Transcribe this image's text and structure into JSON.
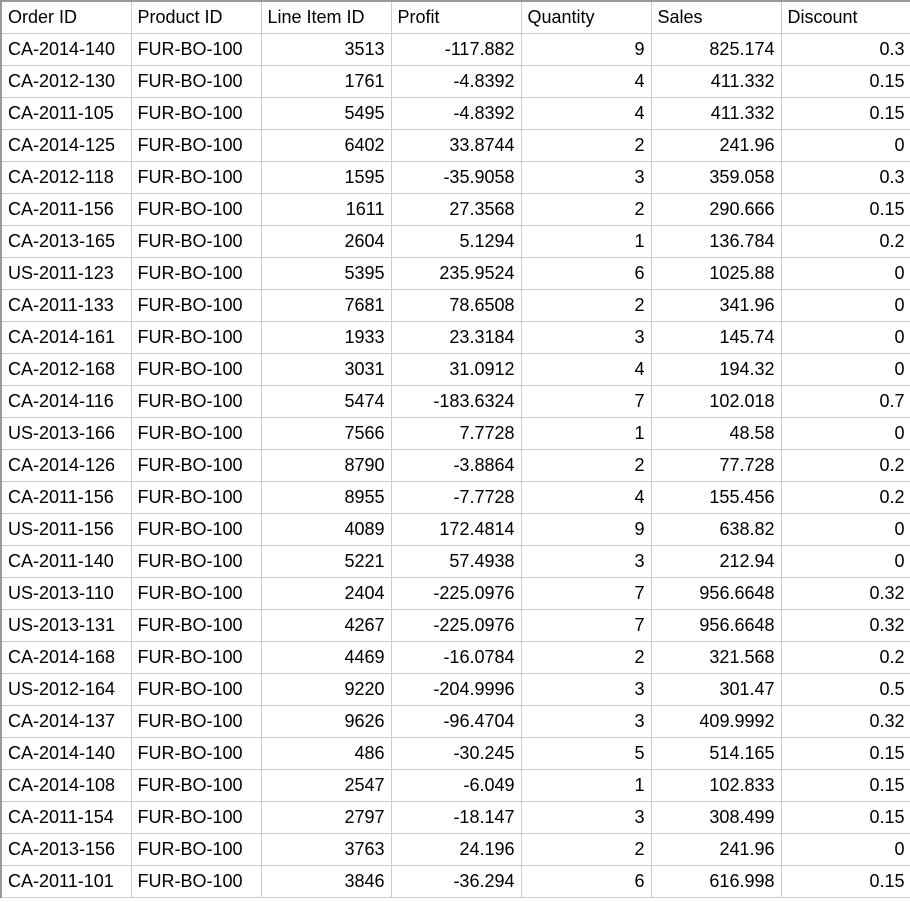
{
  "headers": {
    "order_id": "Order ID",
    "product_id": "Product ID",
    "line_item_id": "Line Item ID",
    "profit": "Profit",
    "quantity": "Quantity",
    "sales": "Sales",
    "discount": "Discount"
  },
  "rows": [
    {
      "order_id": "CA-2014-140",
      "product_id": "FUR-BO-100",
      "line_item_id": "3513",
      "profit": "-117.882",
      "quantity": "9",
      "sales": "825.174",
      "discount": "0.3"
    },
    {
      "order_id": "CA-2012-130",
      "product_id": "FUR-BO-100",
      "line_item_id": "1761",
      "profit": "-4.8392",
      "quantity": "4",
      "sales": "411.332",
      "discount": "0.15"
    },
    {
      "order_id": "CA-2011-105",
      "product_id": "FUR-BO-100",
      "line_item_id": "5495",
      "profit": "-4.8392",
      "quantity": "4",
      "sales": "411.332",
      "discount": "0.15"
    },
    {
      "order_id": "CA-2014-125",
      "product_id": "FUR-BO-100",
      "line_item_id": "6402",
      "profit": "33.8744",
      "quantity": "2",
      "sales": "241.96",
      "discount": "0"
    },
    {
      "order_id": "CA-2012-118",
      "product_id": "FUR-BO-100",
      "line_item_id": "1595",
      "profit": "-35.9058",
      "quantity": "3",
      "sales": "359.058",
      "discount": "0.3"
    },
    {
      "order_id": "CA-2011-156",
      "product_id": "FUR-BO-100",
      "line_item_id": "1611",
      "profit": "27.3568",
      "quantity": "2",
      "sales": "290.666",
      "discount": "0.15"
    },
    {
      "order_id": "CA-2013-165",
      "product_id": "FUR-BO-100",
      "line_item_id": "2604",
      "profit": "5.1294",
      "quantity": "1",
      "sales": "136.784",
      "discount": "0.2"
    },
    {
      "order_id": "US-2011-123",
      "product_id": "FUR-BO-100",
      "line_item_id": "5395",
      "profit": "235.9524",
      "quantity": "6",
      "sales": "1025.88",
      "discount": "0"
    },
    {
      "order_id": "CA-2011-133",
      "product_id": "FUR-BO-100",
      "line_item_id": "7681",
      "profit": "78.6508",
      "quantity": "2",
      "sales": "341.96",
      "discount": "0"
    },
    {
      "order_id": "CA-2014-161",
      "product_id": "FUR-BO-100",
      "line_item_id": "1933",
      "profit": "23.3184",
      "quantity": "3",
      "sales": "145.74",
      "discount": "0"
    },
    {
      "order_id": "CA-2012-168",
      "product_id": "FUR-BO-100",
      "line_item_id": "3031",
      "profit": "31.0912",
      "quantity": "4",
      "sales": "194.32",
      "discount": "0"
    },
    {
      "order_id": "CA-2014-116",
      "product_id": "FUR-BO-100",
      "line_item_id": "5474",
      "profit": "-183.6324",
      "quantity": "7",
      "sales": "102.018",
      "discount": "0.7"
    },
    {
      "order_id": "US-2013-166",
      "product_id": "FUR-BO-100",
      "line_item_id": "7566",
      "profit": "7.7728",
      "quantity": "1",
      "sales": "48.58",
      "discount": "0"
    },
    {
      "order_id": "CA-2014-126",
      "product_id": "FUR-BO-100",
      "line_item_id": "8790",
      "profit": "-3.8864",
      "quantity": "2",
      "sales": "77.728",
      "discount": "0.2"
    },
    {
      "order_id": "CA-2011-156",
      "product_id": "FUR-BO-100",
      "line_item_id": "8955",
      "profit": "-7.7728",
      "quantity": "4",
      "sales": "155.456",
      "discount": "0.2"
    },
    {
      "order_id": "US-2011-156",
      "product_id": "FUR-BO-100",
      "line_item_id": "4089",
      "profit": "172.4814",
      "quantity": "9",
      "sales": "638.82",
      "discount": "0"
    },
    {
      "order_id": "CA-2011-140",
      "product_id": "FUR-BO-100",
      "line_item_id": "5221",
      "profit": "57.4938",
      "quantity": "3",
      "sales": "212.94",
      "discount": "0"
    },
    {
      "order_id": "US-2013-110",
      "product_id": "FUR-BO-100",
      "line_item_id": "2404",
      "profit": "-225.0976",
      "quantity": "7",
      "sales": "956.6648",
      "discount": "0.32"
    },
    {
      "order_id": "US-2013-131",
      "product_id": "FUR-BO-100",
      "line_item_id": "4267",
      "profit": "-225.0976",
      "quantity": "7",
      "sales": "956.6648",
      "discount": "0.32"
    },
    {
      "order_id": "CA-2014-168",
      "product_id": "FUR-BO-100",
      "line_item_id": "4469",
      "profit": "-16.0784",
      "quantity": "2",
      "sales": "321.568",
      "discount": "0.2"
    },
    {
      "order_id": "US-2012-164",
      "product_id": "FUR-BO-100",
      "line_item_id": "9220",
      "profit": "-204.9996",
      "quantity": "3",
      "sales": "301.47",
      "discount": "0.5"
    },
    {
      "order_id": "CA-2014-137",
      "product_id": "FUR-BO-100",
      "line_item_id": "9626",
      "profit": "-96.4704",
      "quantity": "3",
      "sales": "409.9992",
      "discount": "0.32"
    },
    {
      "order_id": "CA-2014-140",
      "product_id": "FUR-BO-100",
      "line_item_id": "486",
      "profit": "-30.245",
      "quantity": "5",
      "sales": "514.165",
      "discount": "0.15"
    },
    {
      "order_id": "CA-2014-108",
      "product_id": "FUR-BO-100",
      "line_item_id": "2547",
      "profit": "-6.049",
      "quantity": "1",
      "sales": "102.833",
      "discount": "0.15"
    },
    {
      "order_id": "CA-2011-154",
      "product_id": "FUR-BO-100",
      "line_item_id": "2797",
      "profit": "-18.147",
      "quantity": "3",
      "sales": "308.499",
      "discount": "0.15"
    },
    {
      "order_id": "CA-2013-156",
      "product_id": "FUR-BO-100",
      "line_item_id": "3763",
      "profit": "24.196",
      "quantity": "2",
      "sales": "241.96",
      "discount": "0"
    },
    {
      "order_id": "CA-2011-101",
      "product_id": "FUR-BO-100",
      "line_item_id": "3846",
      "profit": "-36.294",
      "quantity": "6",
      "sales": "616.998",
      "discount": "0.15"
    }
  ]
}
